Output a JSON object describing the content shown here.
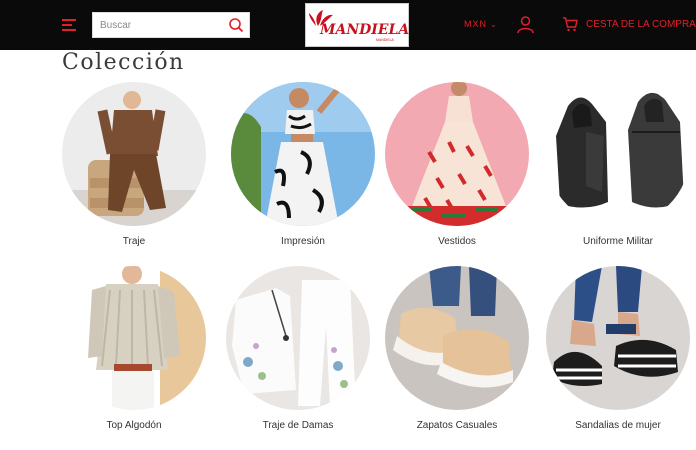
{
  "header": {
    "search_placeholder": "Buscar",
    "logo_text": "MANDIELA",
    "logo_subtext": "MANDIELA",
    "currency": "MXN",
    "cart_label": "CESTA DE LA COMPRA",
    "icons": {
      "menu": "hamburger-menu-icon",
      "search": "search-icon",
      "user": "user-icon",
      "cart": "shopping-cart-icon",
      "chevron": "chevron-down-icon"
    },
    "colors": {
      "bar": "#0a0a0a",
      "accent": "#e0202a"
    }
  },
  "collection": {
    "title": "Colección",
    "items": [
      {
        "label": "Traje"
      },
      {
        "label": "Impresión"
      },
      {
        "label": "Vestidos"
      },
      {
        "label": "Uniforme Militar"
      },
      {
        "label": "Top Algodón"
      },
      {
        "label": "Traje de Damas"
      },
      {
        "label": "Zapatos Casuales"
      },
      {
        "label": "Sandalias de mujer"
      }
    ]
  }
}
